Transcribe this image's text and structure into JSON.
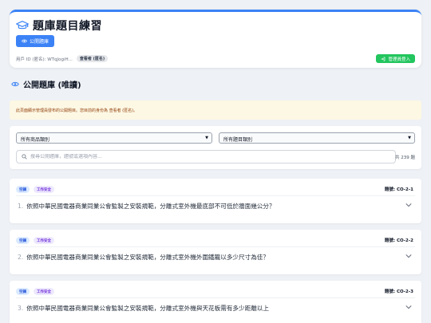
{
  "header": {
    "title": "題庫題目練習",
    "public_button": "公開題庫",
    "user_id": "用戶 ID (匿名): WTqJogiH...",
    "role_badge": "查看者 (匿名)",
    "admin_button": "管理員登入"
  },
  "section": {
    "title": "公開題庫 (唯讀)"
  },
  "notice": "此頁面顯示管理員發布的公開題目。您目前的身份為 查看者 (匿名)。",
  "filters": {
    "category_select": "所有商品類別",
    "type_select": "所有題目類別",
    "search_placeholder": "搜尋公開題庫，題號或選項內容...",
    "count": "共 239 題"
  },
  "questions": [
    {
      "tag1": "空調",
      "tag2": "工作安全",
      "id": "題號: CO-2-1",
      "number": "1.",
      "text": "依照中華民國電器商業同業公會監製之安裝規範，分離式室外機最底部不可低於牆面幾公分？"
    },
    {
      "tag1": "空調",
      "tag2": "工作安全",
      "id": "題號: CO-2-2",
      "number": "2.",
      "text": "依照中華民國電器商業同業公會監製之安裝規範，分離式室外機外圍鐵籠以多少尺寸為佳？"
    },
    {
      "tag1": "空調",
      "tag2": "工作安全",
      "id": "題號: CO-2-3",
      "number": "3.",
      "text": "依照中華民國電器商業同業公會監製之安裝規範，分離式室外機與天花板需有多少距離以上"
    }
  ],
  "colors": {
    "accent": "#3b82f6",
    "admin": "#22c55e",
    "notice_bg": "#fdf8e4"
  }
}
